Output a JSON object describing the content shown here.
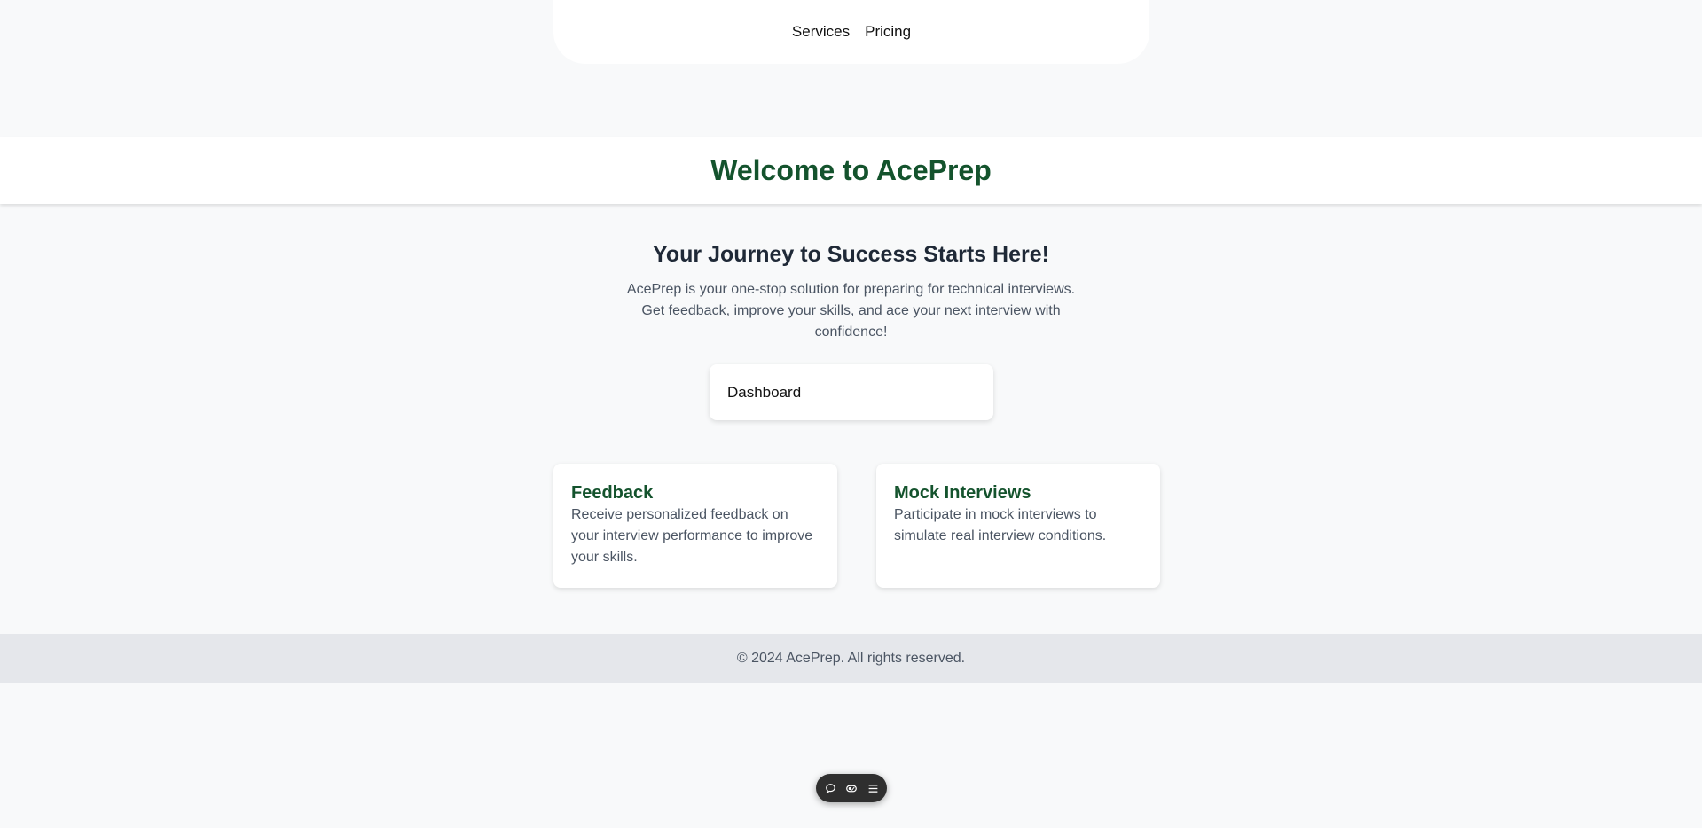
{
  "nav": {
    "links": [
      {
        "label": "Services"
      },
      {
        "label": "Pricing"
      }
    ]
  },
  "header": {
    "title": "Welcome to AcePrep"
  },
  "hero": {
    "title": "Your Journey to Success Starts Here!",
    "description": "AcePrep is your one-stop solution for preparing for technical interviews. Get feedback, improve your skills, and ace your next interview with confidence!"
  },
  "dashboard": {
    "label": "Dashboard"
  },
  "features": [
    {
      "title": "Feedback",
      "text": "Receive personalized feedback on your interview performance to improve your skills."
    },
    {
      "title": "Mock Interviews",
      "text": "Participate in mock interviews to simulate real interview conditions."
    }
  ],
  "footer": {
    "text": "© 2024 AcePrep. All rights reserved."
  },
  "toolbar": {
    "icons": [
      "chat-icon",
      "toggle-icon",
      "menu-icon"
    ]
  },
  "colors": {
    "brand_green": "#14532d",
    "background": "#f8f9fa",
    "footer_bg": "#e5e7eb",
    "toolbar_bg": "#2f2f2f"
  }
}
